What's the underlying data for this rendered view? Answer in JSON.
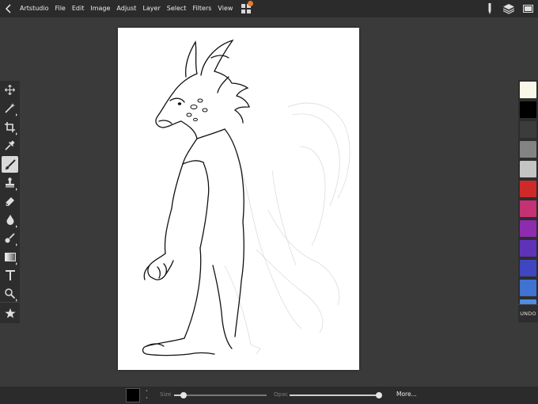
{
  "menu": {
    "app_name": "Artstudio",
    "items": [
      "File",
      "Edit",
      "Image",
      "Adjust",
      "Layer",
      "Select",
      "Filters",
      "View"
    ]
  },
  "icons": {
    "back": "chevron-left-icon",
    "gallery": "grid-icon",
    "pencil": "pencil-icon",
    "layers": "layers-icon",
    "fullscreen": "fullscreen-icon"
  },
  "tools": [
    "move",
    "magic-wand",
    "crop",
    "eyedropper",
    "brush",
    "stamp",
    "eraser",
    "smudge",
    "fill",
    "gradient",
    "text",
    "zoom",
    "favorites"
  ],
  "active_tool": "brush",
  "palette": {
    "colors": [
      "#f8f6e8",
      "#000000",
      "#3c3c3c",
      "#838383",
      "#c4c4c4",
      "#cf2a2a",
      "#c43273",
      "#8e2cb0",
      "#5f33b9",
      "#3f46c0",
      "#3f72d1",
      "#4f8de0"
    ],
    "undo_label": "UNDO"
  },
  "bottom": {
    "current_color": "#000000",
    "size_label": "Size",
    "size_value": 0.1,
    "opacity_label": "Opac",
    "opacity_value": 1.0,
    "more_label": "More..."
  }
}
